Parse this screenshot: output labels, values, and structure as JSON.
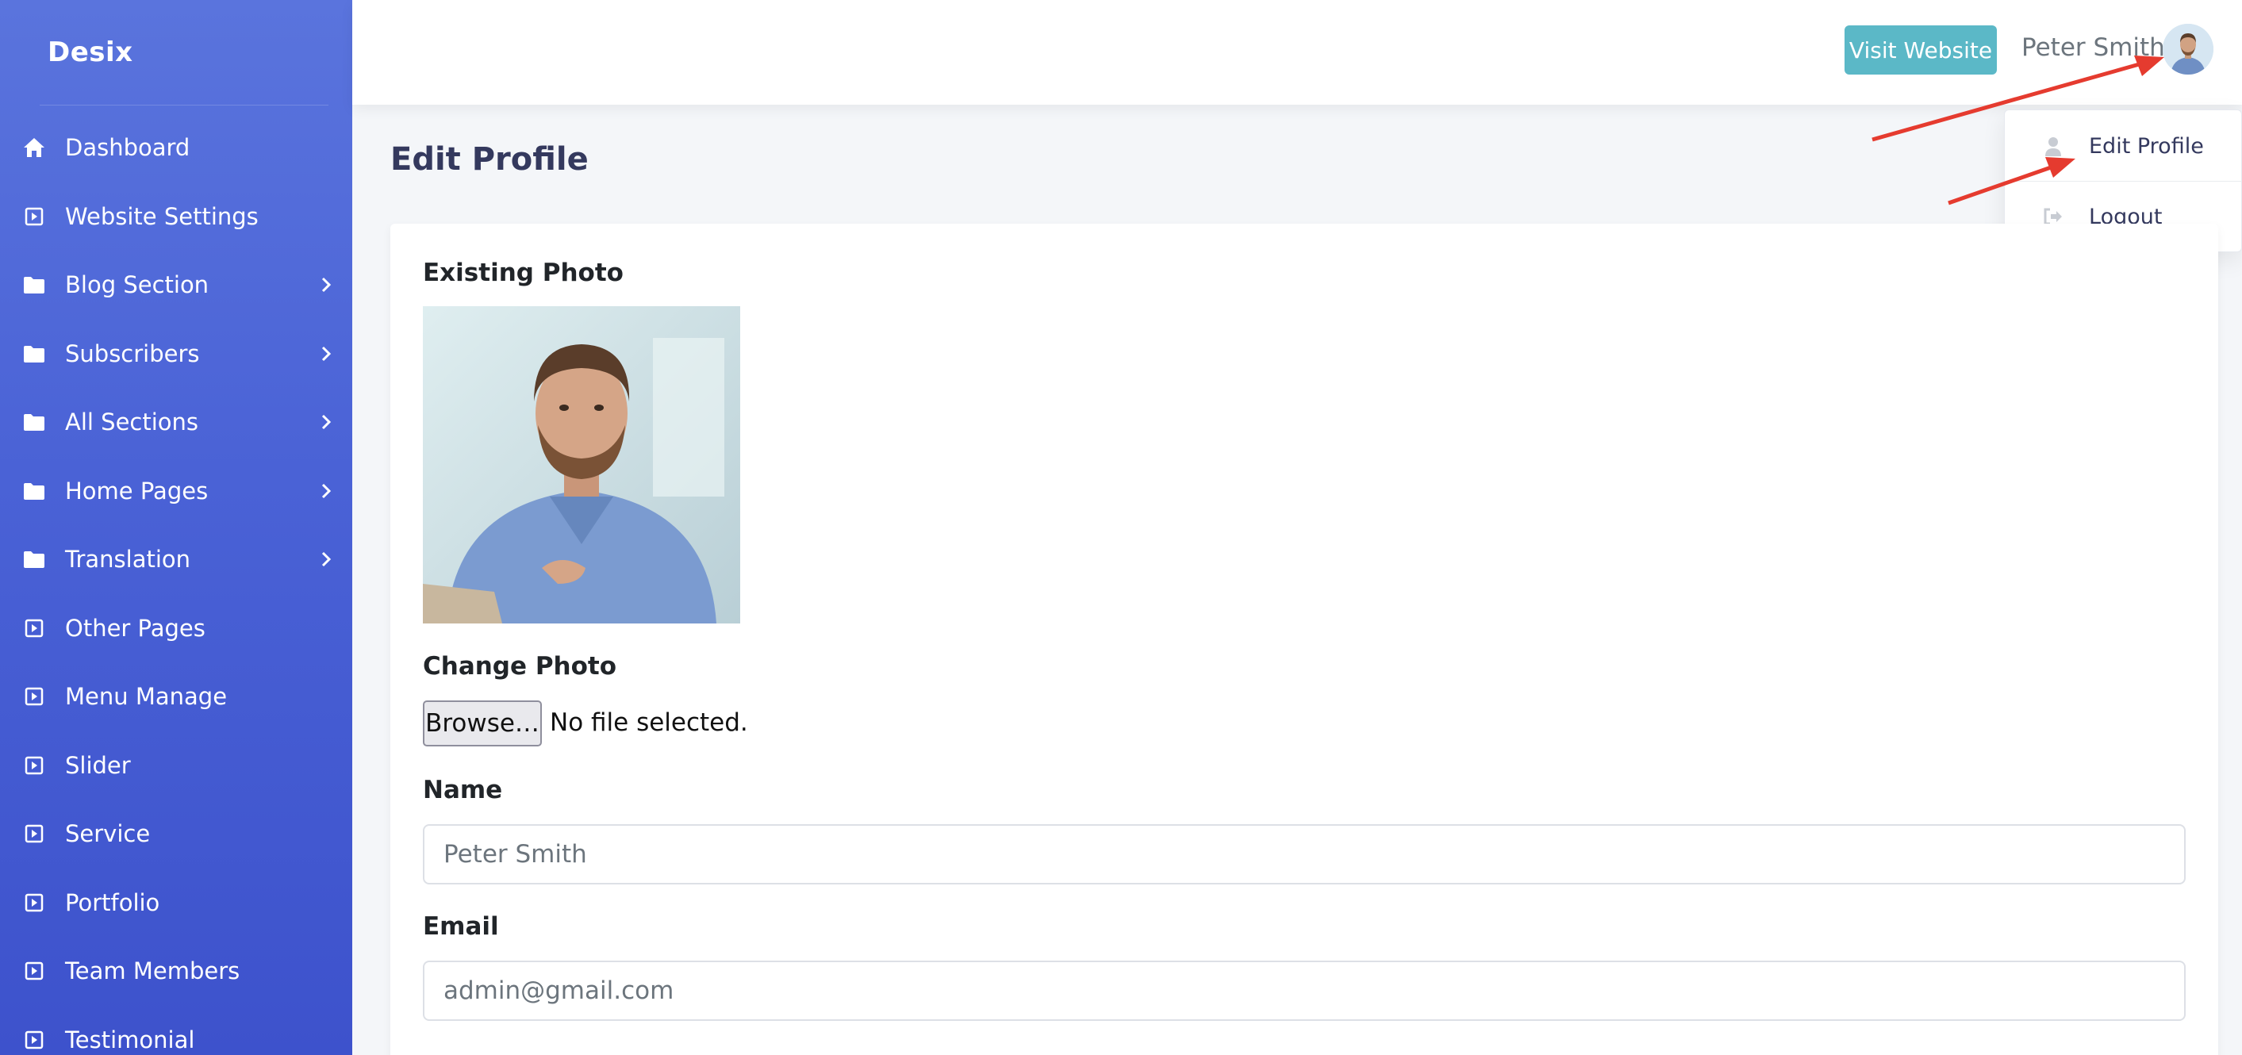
{
  "brand": "Desix",
  "sidebar": {
    "items": [
      {
        "label": "Dashboard",
        "icon": "home-icon",
        "has_submenu": false
      },
      {
        "label": "Website Settings",
        "icon": "square-arrow-icon",
        "has_submenu": false
      },
      {
        "label": "Blog Section",
        "icon": "folder-icon",
        "has_submenu": true
      },
      {
        "label": "Subscribers",
        "icon": "folder-icon",
        "has_submenu": true
      },
      {
        "label": "All Sections",
        "icon": "folder-icon",
        "has_submenu": true
      },
      {
        "label": "Home Pages",
        "icon": "folder-icon",
        "has_submenu": true
      },
      {
        "label": "Translation",
        "icon": "folder-icon",
        "has_submenu": true
      },
      {
        "label": "Other Pages",
        "icon": "square-arrow-icon",
        "has_submenu": false
      },
      {
        "label": "Menu Manage",
        "icon": "square-arrow-icon",
        "has_submenu": false
      },
      {
        "label": "Slider",
        "icon": "square-arrow-icon",
        "has_submenu": false
      },
      {
        "label": "Service",
        "icon": "square-arrow-icon",
        "has_submenu": false
      },
      {
        "label": "Portfolio",
        "icon": "square-arrow-icon",
        "has_submenu": false
      },
      {
        "label": "Team Members",
        "icon": "square-arrow-icon",
        "has_submenu": false
      },
      {
        "label": "Testimonial",
        "icon": "square-arrow-icon",
        "has_submenu": false
      }
    ]
  },
  "header": {
    "visit_website": "Visit Website",
    "user_name": "Peter Smith"
  },
  "dropdown": {
    "items": [
      {
        "label": "Edit Profile",
        "icon": "user-icon"
      },
      {
        "label": "Logout",
        "icon": "sign-out-icon"
      }
    ]
  },
  "main": {
    "title": "Edit Profile",
    "existing_photo_label": "Existing Photo",
    "change_photo_label": "Change Photo",
    "browse_label": "Browse…",
    "file_status": "No file selected.",
    "name_label": "Name",
    "name_value": "Peter Smith",
    "email_label": "Email",
    "email_value": "admin@gmail.com"
  },
  "colors": {
    "sidebar_top": "#5a74dd",
    "sidebar_bottom": "#3d52cc",
    "visit_button": "#5bb8c7",
    "annotation_arrow": "#e53b2f"
  }
}
